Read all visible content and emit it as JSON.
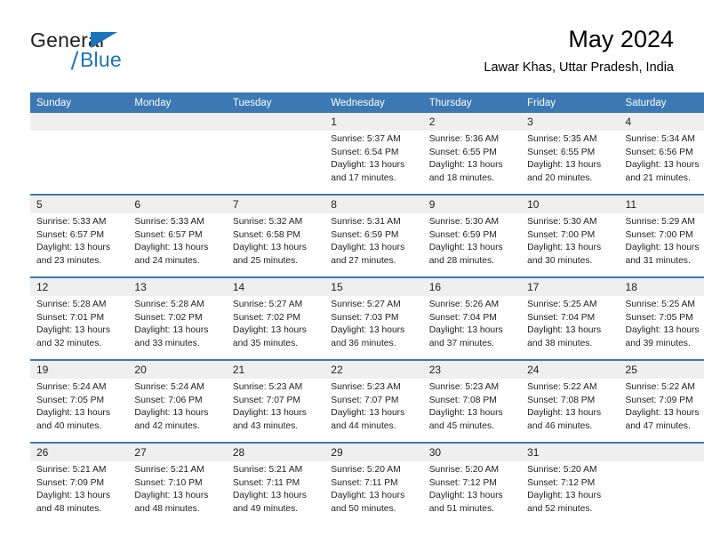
{
  "logo": {
    "word1": "General",
    "word2": "Blue",
    "triangle_color": "#1b75bb"
  },
  "header": {
    "title": "May 2024",
    "subtitle": "Lawar Khas, Uttar Pradesh, India"
  },
  "theme": {
    "header_blue": "#3b78b4",
    "daynum_gray": "#efefef",
    "text": "#222222"
  },
  "calendar": {
    "weekday_headers": [
      "Sunday",
      "Monday",
      "Tuesday",
      "Wednesday",
      "Thursday",
      "Friday",
      "Saturday"
    ],
    "weeks": [
      [
        {
          "day": "",
          "lines": []
        },
        {
          "day": "",
          "lines": []
        },
        {
          "day": "",
          "lines": []
        },
        {
          "day": "1",
          "lines": [
            "Sunrise: 5:37 AM",
            "Sunset: 6:54 PM",
            "Daylight: 13 hours",
            "and 17 minutes."
          ]
        },
        {
          "day": "2",
          "lines": [
            "Sunrise: 5:36 AM",
            "Sunset: 6:55 PM",
            "Daylight: 13 hours",
            "and 18 minutes."
          ]
        },
        {
          "day": "3",
          "lines": [
            "Sunrise: 5:35 AM",
            "Sunset: 6:55 PM",
            "Daylight: 13 hours",
            "and 20 minutes."
          ]
        },
        {
          "day": "4",
          "lines": [
            "Sunrise: 5:34 AM",
            "Sunset: 6:56 PM",
            "Daylight: 13 hours",
            "and 21 minutes."
          ]
        }
      ],
      [
        {
          "day": "5",
          "lines": [
            "Sunrise: 5:33 AM",
            "Sunset: 6:57 PM",
            "Daylight: 13 hours",
            "and 23 minutes."
          ]
        },
        {
          "day": "6",
          "lines": [
            "Sunrise: 5:33 AM",
            "Sunset: 6:57 PM",
            "Daylight: 13 hours",
            "and 24 minutes."
          ]
        },
        {
          "day": "7",
          "lines": [
            "Sunrise: 5:32 AM",
            "Sunset: 6:58 PM",
            "Daylight: 13 hours",
            "and 25 minutes."
          ]
        },
        {
          "day": "8",
          "lines": [
            "Sunrise: 5:31 AM",
            "Sunset: 6:59 PM",
            "Daylight: 13 hours",
            "and 27 minutes."
          ]
        },
        {
          "day": "9",
          "lines": [
            "Sunrise: 5:30 AM",
            "Sunset: 6:59 PM",
            "Daylight: 13 hours",
            "and 28 minutes."
          ]
        },
        {
          "day": "10",
          "lines": [
            "Sunrise: 5:30 AM",
            "Sunset: 7:00 PM",
            "Daylight: 13 hours",
            "and 30 minutes."
          ]
        },
        {
          "day": "11",
          "lines": [
            "Sunrise: 5:29 AM",
            "Sunset: 7:00 PM",
            "Daylight: 13 hours",
            "and 31 minutes."
          ]
        }
      ],
      [
        {
          "day": "12",
          "lines": [
            "Sunrise: 5:28 AM",
            "Sunset: 7:01 PM",
            "Daylight: 13 hours",
            "and 32 minutes."
          ]
        },
        {
          "day": "13",
          "lines": [
            "Sunrise: 5:28 AM",
            "Sunset: 7:02 PM",
            "Daylight: 13 hours",
            "and 33 minutes."
          ]
        },
        {
          "day": "14",
          "lines": [
            "Sunrise: 5:27 AM",
            "Sunset: 7:02 PM",
            "Daylight: 13 hours",
            "and 35 minutes."
          ]
        },
        {
          "day": "15",
          "lines": [
            "Sunrise: 5:27 AM",
            "Sunset: 7:03 PM",
            "Daylight: 13 hours",
            "and 36 minutes."
          ]
        },
        {
          "day": "16",
          "lines": [
            "Sunrise: 5:26 AM",
            "Sunset: 7:04 PM",
            "Daylight: 13 hours",
            "and 37 minutes."
          ]
        },
        {
          "day": "17",
          "lines": [
            "Sunrise: 5:25 AM",
            "Sunset: 7:04 PM",
            "Daylight: 13 hours",
            "and 38 minutes."
          ]
        },
        {
          "day": "18",
          "lines": [
            "Sunrise: 5:25 AM",
            "Sunset: 7:05 PM",
            "Daylight: 13 hours",
            "and 39 minutes."
          ]
        }
      ],
      [
        {
          "day": "19",
          "lines": [
            "Sunrise: 5:24 AM",
            "Sunset: 7:05 PM",
            "Daylight: 13 hours",
            "and 40 minutes."
          ]
        },
        {
          "day": "20",
          "lines": [
            "Sunrise: 5:24 AM",
            "Sunset: 7:06 PM",
            "Daylight: 13 hours",
            "and 42 minutes."
          ]
        },
        {
          "day": "21",
          "lines": [
            "Sunrise: 5:23 AM",
            "Sunset: 7:07 PM",
            "Daylight: 13 hours",
            "and 43 minutes."
          ]
        },
        {
          "day": "22",
          "lines": [
            "Sunrise: 5:23 AM",
            "Sunset: 7:07 PM",
            "Daylight: 13 hours",
            "and 44 minutes."
          ]
        },
        {
          "day": "23",
          "lines": [
            "Sunrise: 5:23 AM",
            "Sunset: 7:08 PM",
            "Daylight: 13 hours",
            "and 45 minutes."
          ]
        },
        {
          "day": "24",
          "lines": [
            "Sunrise: 5:22 AM",
            "Sunset: 7:08 PM",
            "Daylight: 13 hours",
            "and 46 minutes."
          ]
        },
        {
          "day": "25",
          "lines": [
            "Sunrise: 5:22 AM",
            "Sunset: 7:09 PM",
            "Daylight: 13 hours",
            "and 47 minutes."
          ]
        }
      ],
      [
        {
          "day": "26",
          "lines": [
            "Sunrise: 5:21 AM",
            "Sunset: 7:09 PM",
            "Daylight: 13 hours",
            "and 48 minutes."
          ]
        },
        {
          "day": "27",
          "lines": [
            "Sunrise: 5:21 AM",
            "Sunset: 7:10 PM",
            "Daylight: 13 hours",
            "and 48 minutes."
          ]
        },
        {
          "day": "28",
          "lines": [
            "Sunrise: 5:21 AM",
            "Sunset: 7:11 PM",
            "Daylight: 13 hours",
            "and 49 minutes."
          ]
        },
        {
          "day": "29",
          "lines": [
            "Sunrise: 5:20 AM",
            "Sunset: 7:11 PM",
            "Daylight: 13 hours",
            "and 50 minutes."
          ]
        },
        {
          "day": "30",
          "lines": [
            "Sunrise: 5:20 AM",
            "Sunset: 7:12 PM",
            "Daylight: 13 hours",
            "and 51 minutes."
          ]
        },
        {
          "day": "31",
          "lines": [
            "Sunrise: 5:20 AM",
            "Sunset: 7:12 PM",
            "Daylight: 13 hours",
            "and 52 minutes."
          ]
        },
        {
          "day": "",
          "lines": []
        }
      ]
    ]
  }
}
